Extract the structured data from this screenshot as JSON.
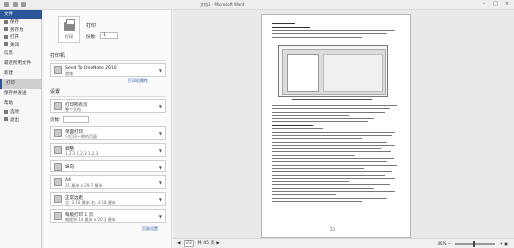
{
  "titlebar": {
    "title": "文档1 - Microsoft Word"
  },
  "backstage": {
    "file_tab": "文件",
    "items": [
      {
        "label": "保存"
      },
      {
        "label": "另存为"
      },
      {
        "label": "打开"
      },
      {
        "label": "关闭"
      },
      {
        "label": "信息"
      },
      {
        "label": "最近所用文件"
      },
      {
        "label": "新建"
      },
      {
        "label": "打印"
      },
      {
        "label": "保存并发送"
      },
      {
        "label": "帮助"
      },
      {
        "label": "选项"
      },
      {
        "label": "退出"
      }
    ]
  },
  "print_panel": {
    "heading": "打印",
    "print_button": "打印",
    "copies_label": "份数:",
    "copies_value": "1",
    "printer_section": "打印机",
    "printer_name": "Send To OneNote 2010",
    "printer_status": "就绪",
    "printer_properties": "打印机属性",
    "settings_section": "设置",
    "pages_label": "页数:",
    "settings": [
      {
        "t1": "打印所有页",
        "t2": "整个文档"
      },
      {
        "t1": "单面打印",
        "t2": "只打印一侧的页面"
      },
      {
        "t1": "调整",
        "t2": "1,2,3   1,2,3   1,2,3"
      },
      {
        "t1": "纵向",
        "t2": ""
      },
      {
        "t1": "A4",
        "t2": "21 厘米 x 29.7 厘米"
      },
      {
        "t1": "正常边距",
        "t2": "左: 3.18 厘米   右: 3.18 厘米"
      },
      {
        "t1": "每版打印 1 页",
        "t2": "缩放到 14 厘米 x 20.3 厘米"
      }
    ],
    "page_setup": "页面设置"
  },
  "preview": {
    "page_footer": "23"
  },
  "statusbar": {
    "prev": "◀",
    "current_page": "23",
    "total": "共 45 页",
    "next": "▶",
    "zoom_value": "46%",
    "zoom_level": 0.46
  }
}
